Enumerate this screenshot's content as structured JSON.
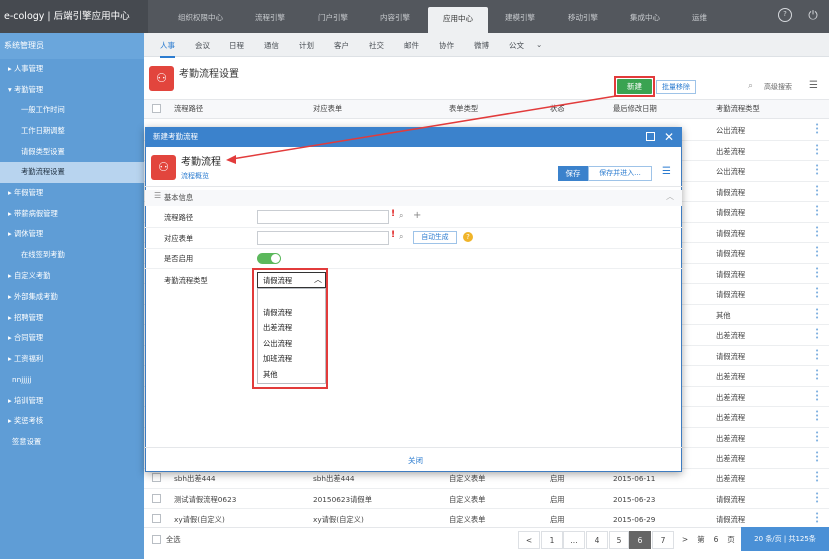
{
  "brand": "e-cology | 后端引擎应用中心",
  "top_tabs": [
    "组织权限中心",
    "流程引擎",
    "门户引擎",
    "内容引擎",
    "应用中心",
    "建模引擎",
    "移动引擎",
    "集成中心",
    "运维"
  ],
  "top_icons": {
    "help": "?",
    "power": "⏻"
  },
  "sidebar": {
    "header": "系统管理员",
    "items": [
      "▸ 人事管理",
      "▾ 考勤管理",
      "一般工作时间",
      "工作日期调整",
      "请假类型设置",
      "考勤流程设置",
      "▸ 年假管理",
      "▸ 带薪病假管理",
      "▸ 调休管理",
      "在线签到考勤",
      "▸ 自定义考勤",
      "▸ 外部集成考勤",
      "▸ 招聘管理",
      "▸ 合同管理",
      "▸ 工资福利",
      "nnjjjjj",
      "▸ 培训管理",
      "▸ 奖惩考核",
      "签意设置"
    ]
  },
  "subnav": [
    "人事",
    "会议",
    "日程",
    "通信",
    "计划",
    "客户",
    "社交",
    "邮件",
    "协作",
    "微博",
    "公文",
    "⌄"
  ],
  "page": {
    "title": "考勤流程设置",
    "new_label": "新建",
    "batch_label": "批量移除",
    "adv_search": "高级搜索"
  },
  "table": {
    "headers": [
      "流程路径",
      "对应表单",
      "表单类型",
      "状态",
      "最后修改日期",
      "考勤流程类型"
    ],
    "right_col": [
      "公出流程",
      "出差流程",
      "公出流程",
      "请假流程",
      "请假流程",
      "请假流程",
      "请假流程",
      "请假流程",
      "请假流程",
      "其他",
      "出差流程",
      "请假流程",
      "出差流程",
      "出差流程",
      "出差流程",
      "出差流程",
      "出差流程"
    ],
    "bottom_rows": [
      [
        "sbh出差444",
        "sbh出差444",
        "自定义表单",
        "启用",
        "2015-06-11",
        "出差流程"
      ],
      [
        "测试请假流程0623",
        "20150623请假单",
        "自定义表单",
        "启用",
        "2015-06-23",
        "请假流程"
      ],
      [
        "xy请假(自定义)",
        "xy请假(自定义)",
        "自定义表单",
        "启用",
        "2015-06-29",
        "请假流程"
      ]
    ]
  },
  "pager": {
    "select_all": "全选",
    "pages": [
      "<",
      "1",
      "...",
      "4",
      "5",
      "6",
      "7",
      ">",
      "第",
      "6",
      "页"
    ],
    "size": "20",
    "summary": "条/页 | 共125条"
  },
  "dialog": {
    "title": "新建考勤流程",
    "name": "考勤流程",
    "subtitle": "流程概览",
    "save": "保存",
    "save_enter": "保存并进入...",
    "section": "基本信息",
    "fields": {
      "path_label": "流程路径",
      "form_label": "对应表单",
      "enabled_label": "是否启用",
      "type_label": "考勤流程类型"
    },
    "auto_gen": "自动生成",
    "help": "?",
    "select_value": "请假流程",
    "options": [
      "请假流程",
      "出差流程",
      "公出流程",
      "加班流程",
      "其他"
    ],
    "close": "关闭"
  },
  "colors": {
    "accent": "#3b82cc",
    "sidebar": "#5f9dd6",
    "danger": "#e23b3b",
    "green": "#3aa351"
  }
}
